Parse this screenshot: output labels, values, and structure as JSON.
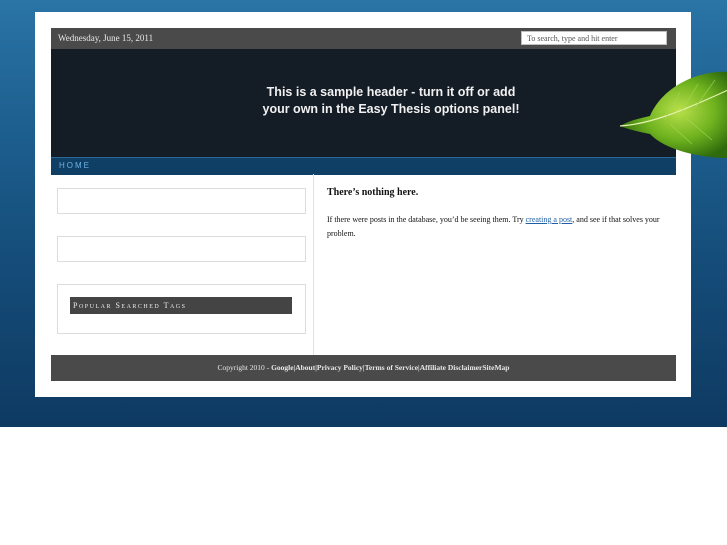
{
  "topbar": {
    "date": "Wednesday, June 15, 2011",
    "search_placeholder": "To search, type and hit enter"
  },
  "header": {
    "line1": "This is a sample header - turn it off or add",
    "line2": "your own in the Easy Thesis options panel!"
  },
  "nav": {
    "home": "HOME"
  },
  "sidebar": {
    "widget3_title": "Popular Searched Tags"
  },
  "content": {
    "title": "There’s nothing here.",
    "text_before": "If there were posts in the database, you’d be seeing them. Try ",
    "link": "creating a post",
    "text_after": ", and see if that solves your problem."
  },
  "footer": {
    "copyright": "Copyright 2010 - ",
    "links": [
      "Google",
      "About",
      "Privacy Policy",
      "Terms of Service",
      "Affiliate Disclaimer",
      "SiteMap"
    ]
  },
  "colors": {
    "background_top": "#2a74a6",
    "background_bottom": "#0e3a62",
    "header_bg": "#141c25",
    "nav_bg": "#0f3f64",
    "bar_bg": "#4a4a4a",
    "link": "#1f5fa6"
  },
  "icons": {
    "header_image": "green-leaf-icon"
  }
}
